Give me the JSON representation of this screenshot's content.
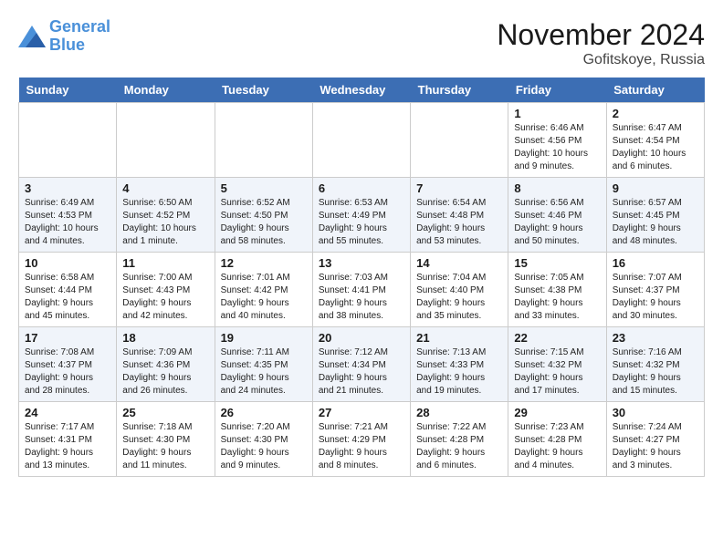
{
  "header": {
    "logo_line1": "General",
    "logo_line2": "Blue",
    "month": "November 2024",
    "location": "Gofitskoye, Russia"
  },
  "weekdays": [
    "Sunday",
    "Monday",
    "Tuesday",
    "Wednesday",
    "Thursday",
    "Friday",
    "Saturday"
  ],
  "weeks": [
    [
      {
        "day": "",
        "info": ""
      },
      {
        "day": "",
        "info": ""
      },
      {
        "day": "",
        "info": ""
      },
      {
        "day": "",
        "info": ""
      },
      {
        "day": "",
        "info": ""
      },
      {
        "day": "1",
        "info": "Sunrise: 6:46 AM\nSunset: 4:56 PM\nDaylight: 10 hours and 9 minutes."
      },
      {
        "day": "2",
        "info": "Sunrise: 6:47 AM\nSunset: 4:54 PM\nDaylight: 10 hours and 6 minutes."
      }
    ],
    [
      {
        "day": "3",
        "info": "Sunrise: 6:49 AM\nSunset: 4:53 PM\nDaylight: 10 hours and 4 minutes."
      },
      {
        "day": "4",
        "info": "Sunrise: 6:50 AM\nSunset: 4:52 PM\nDaylight: 10 hours and 1 minute."
      },
      {
        "day": "5",
        "info": "Sunrise: 6:52 AM\nSunset: 4:50 PM\nDaylight: 9 hours and 58 minutes."
      },
      {
        "day": "6",
        "info": "Sunrise: 6:53 AM\nSunset: 4:49 PM\nDaylight: 9 hours and 55 minutes."
      },
      {
        "day": "7",
        "info": "Sunrise: 6:54 AM\nSunset: 4:48 PM\nDaylight: 9 hours and 53 minutes."
      },
      {
        "day": "8",
        "info": "Sunrise: 6:56 AM\nSunset: 4:46 PM\nDaylight: 9 hours and 50 minutes."
      },
      {
        "day": "9",
        "info": "Sunrise: 6:57 AM\nSunset: 4:45 PM\nDaylight: 9 hours and 48 minutes."
      }
    ],
    [
      {
        "day": "10",
        "info": "Sunrise: 6:58 AM\nSunset: 4:44 PM\nDaylight: 9 hours and 45 minutes."
      },
      {
        "day": "11",
        "info": "Sunrise: 7:00 AM\nSunset: 4:43 PM\nDaylight: 9 hours and 42 minutes."
      },
      {
        "day": "12",
        "info": "Sunrise: 7:01 AM\nSunset: 4:42 PM\nDaylight: 9 hours and 40 minutes."
      },
      {
        "day": "13",
        "info": "Sunrise: 7:03 AM\nSunset: 4:41 PM\nDaylight: 9 hours and 38 minutes."
      },
      {
        "day": "14",
        "info": "Sunrise: 7:04 AM\nSunset: 4:40 PM\nDaylight: 9 hours and 35 minutes."
      },
      {
        "day": "15",
        "info": "Sunrise: 7:05 AM\nSunset: 4:38 PM\nDaylight: 9 hours and 33 minutes."
      },
      {
        "day": "16",
        "info": "Sunrise: 7:07 AM\nSunset: 4:37 PM\nDaylight: 9 hours and 30 minutes."
      }
    ],
    [
      {
        "day": "17",
        "info": "Sunrise: 7:08 AM\nSunset: 4:37 PM\nDaylight: 9 hours and 28 minutes."
      },
      {
        "day": "18",
        "info": "Sunrise: 7:09 AM\nSunset: 4:36 PM\nDaylight: 9 hours and 26 minutes."
      },
      {
        "day": "19",
        "info": "Sunrise: 7:11 AM\nSunset: 4:35 PM\nDaylight: 9 hours and 24 minutes."
      },
      {
        "day": "20",
        "info": "Sunrise: 7:12 AM\nSunset: 4:34 PM\nDaylight: 9 hours and 21 minutes."
      },
      {
        "day": "21",
        "info": "Sunrise: 7:13 AM\nSunset: 4:33 PM\nDaylight: 9 hours and 19 minutes."
      },
      {
        "day": "22",
        "info": "Sunrise: 7:15 AM\nSunset: 4:32 PM\nDaylight: 9 hours and 17 minutes."
      },
      {
        "day": "23",
        "info": "Sunrise: 7:16 AM\nSunset: 4:32 PM\nDaylight: 9 hours and 15 minutes."
      }
    ],
    [
      {
        "day": "24",
        "info": "Sunrise: 7:17 AM\nSunset: 4:31 PM\nDaylight: 9 hours and 13 minutes."
      },
      {
        "day": "25",
        "info": "Sunrise: 7:18 AM\nSunset: 4:30 PM\nDaylight: 9 hours and 11 minutes."
      },
      {
        "day": "26",
        "info": "Sunrise: 7:20 AM\nSunset: 4:30 PM\nDaylight: 9 hours and 9 minutes."
      },
      {
        "day": "27",
        "info": "Sunrise: 7:21 AM\nSunset: 4:29 PM\nDaylight: 9 hours and 8 minutes."
      },
      {
        "day": "28",
        "info": "Sunrise: 7:22 AM\nSunset: 4:28 PM\nDaylight: 9 hours and 6 minutes."
      },
      {
        "day": "29",
        "info": "Sunrise: 7:23 AM\nSunset: 4:28 PM\nDaylight: 9 hours and 4 minutes."
      },
      {
        "day": "30",
        "info": "Sunrise: 7:24 AM\nSunset: 4:27 PM\nDaylight: 9 hours and 3 minutes."
      }
    ]
  ]
}
